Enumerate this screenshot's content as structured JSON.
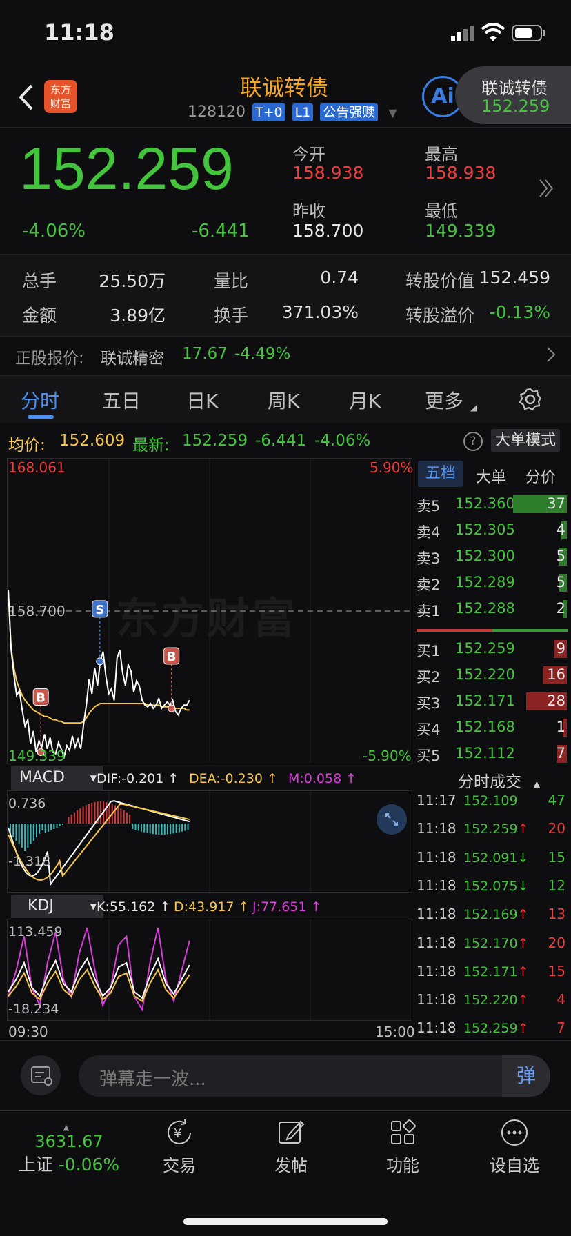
{
  "status": {
    "time": "11:18"
  },
  "header": {
    "title": "联诚转债",
    "code": "128120",
    "badges": [
      "T+0",
      "L1",
      "公告强赎"
    ],
    "logo_text": "东方财富",
    "ai_label": "Ai",
    "float_card": {
      "name": "联诚转债",
      "price": "152.259"
    }
  },
  "quote": {
    "price": "152.259",
    "change_pct": "-4.06%",
    "change": "-6.441",
    "open_label": "今开",
    "open": "158.938",
    "high_label": "最高",
    "high": "158.938",
    "prev_close_label": "昨收",
    "prev_close": "158.700",
    "low_label": "最低",
    "low": "149.339"
  },
  "stats": {
    "volume_label": "总手",
    "volume": "25.50万",
    "vol_ratio_label": "量比",
    "vol_ratio": "0.74",
    "conv_value_label": "转股价值",
    "conv_value": "152.459",
    "amount_label": "金额",
    "amount": "3.89亿",
    "turnover_label": "换手",
    "turnover": "371.03%",
    "premium_label": "转股溢价",
    "premium": "-0.13%"
  },
  "underlying": {
    "label": "正股报价:",
    "name": "联诚精密",
    "price": "17.67",
    "change": "-4.49%"
  },
  "tabs": [
    "分时",
    "五日",
    "日K",
    "周K",
    "月K",
    "更多"
  ],
  "info_bar": {
    "avg_label": "均价:",
    "avg": "152.609",
    "latest_label": "最新:",
    "latest": "152.259",
    "latest_change": "-6.441",
    "latest_pct": "-4.06%",
    "help": "?",
    "mode_button": "大单模式"
  },
  "chart": {
    "y_high": "168.061",
    "y_low": "149.339",
    "pct_high": "5.90%",
    "pct_low": "-5.90%",
    "ref_price": "158.700",
    "watermark": "东方财富",
    "time_start": "09:30",
    "time_end": "15:00",
    "markers": [
      "B",
      "S",
      "B"
    ],
    "macd": {
      "select": "MACD",
      "dif": "DIF:-0.201 ↑",
      "dea": "DEA:-0.230 ↑",
      "m": "M:0.058 ↑",
      "top": "0.736",
      "bottom": "-1.318"
    },
    "kdj": {
      "select": "KDJ",
      "k": "K:55.162 ↑",
      "d": "D:43.917 ↑",
      "j": "J:77.651 ↑",
      "top": "113.459",
      "bottom": "-18.234"
    }
  },
  "chart_data": {
    "type": "line",
    "title": "",
    "x_range": [
      "09:30",
      "15:00"
    ],
    "ylim": [
      149.339,
      168.061
    ],
    "reference": 158.7,
    "series": [
      {
        "name": "",
        "color": "#ffffff",
        "values": [
          160.0,
          156.4,
          154.8,
          153.5,
          153.8,
          152.6,
          151.6,
          152.0,
          150.5,
          151.3,
          150.0,
          150.7,
          150.3,
          151.1,
          150.2,
          150.9,
          150.0,
          149.9,
          150.6,
          150.2,
          149.7,
          150.4,
          150.1,
          151.0,
          150.3,
          150.8,
          150.2,
          151.7,
          152.9,
          154.5,
          153.6,
          155.2,
          154.1,
          155.6,
          156.2,
          154.7,
          153.6,
          153.9,
          153.2,
          155.8,
          156.3,
          154.9,
          154.1,
          155.4,
          155.0,
          153.7,
          154.4,
          154.1,
          153.2,
          152.9,
          152.8,
          153.0,
          152.7,
          152.9,
          153.3,
          152.7,
          152.9,
          153.1,
          152.9,
          153.2,
          152.5,
          152.3,
          152.7,
          152.9,
          152.9,
          153.2
        ]
      },
      {
        "name": "均价",
        "color": "#f5c64a",
        "values": [
          160.0,
          156.5,
          155.2,
          154.4,
          153.9,
          153.5,
          153.2,
          153.0,
          152.8,
          152.6,
          152.5,
          152.4,
          152.3,
          152.2,
          152.2,
          152.1,
          152.0,
          152.0,
          151.9,
          151.9,
          151.8,
          151.8,
          151.8,
          151.8,
          151.8,
          151.8,
          151.8,
          151.9,
          152.1,
          152.4,
          152.6,
          152.8,
          152.9,
          153.0,
          153.0,
          153.0,
          153.0,
          153.0,
          153.0,
          153.0,
          153.0,
          153.0,
          153.0,
          153.0,
          153.0,
          153.0,
          153.0,
          153.0,
          153.0,
          153.0,
          152.9,
          152.9,
          152.9,
          152.9,
          152.9,
          152.8,
          152.8,
          152.8,
          152.8,
          152.8,
          152.7,
          152.7,
          152.7,
          152.7,
          152.6,
          152.6
        ]
      }
    ]
  },
  "order_tabs": [
    "五档",
    "大单",
    "分价"
  ],
  "order_book": {
    "asks": [
      {
        "label": "卖5",
        "price": "152.360",
        "vol": "37"
      },
      {
        "label": "卖4",
        "price": "152.305",
        "vol": "4"
      },
      {
        "label": "卖3",
        "price": "152.300",
        "vol": "5"
      },
      {
        "label": "卖2",
        "price": "152.289",
        "vol": "5"
      },
      {
        "label": "卖1",
        "price": "152.288",
        "vol": "2"
      }
    ],
    "bids": [
      {
        "label": "买1",
        "price": "152.259",
        "vol": "9"
      },
      {
        "label": "买2",
        "price": "152.220",
        "vol": "16"
      },
      {
        "label": "买3",
        "price": "152.171",
        "vol": "28"
      },
      {
        "label": "买4",
        "price": "152.168",
        "vol": "1"
      },
      {
        "label": "买5",
        "price": "152.112",
        "vol": "7"
      }
    ]
  },
  "trades": {
    "title": "分时成交",
    "rows": [
      {
        "time": "11:17",
        "price": "152.109",
        "vol": "47",
        "dir": ""
      },
      {
        "time": "11:18",
        "price": "152.259",
        "vol": "20",
        "dir": "↑"
      },
      {
        "time": "11:18",
        "price": "152.091",
        "vol": "15",
        "dir": "↓"
      },
      {
        "time": "11:18",
        "price": "152.075",
        "vol": "12",
        "dir": "↓"
      },
      {
        "time": "11:18",
        "price": "152.169",
        "vol": "13",
        "dir": "↑"
      },
      {
        "time": "11:18",
        "price": "152.170",
        "vol": "20",
        "dir": "↑"
      },
      {
        "time": "11:18",
        "price": "152.171",
        "vol": "15",
        "dir": "↑"
      },
      {
        "time": "11:18",
        "price": "152.220",
        "vol": "4",
        "dir": "↑"
      },
      {
        "time": "11:18",
        "price": "152.259",
        "vol": "7",
        "dir": "↑"
      }
    ]
  },
  "comment": {
    "placeholder": "弹幕走一波...",
    "send_label": "弹"
  },
  "bottom_nav": {
    "index_value": "3631.67",
    "index_name": "上证",
    "index_change": "-0.06%",
    "items": [
      "交易",
      "发帖",
      "功能",
      "设自选"
    ]
  }
}
